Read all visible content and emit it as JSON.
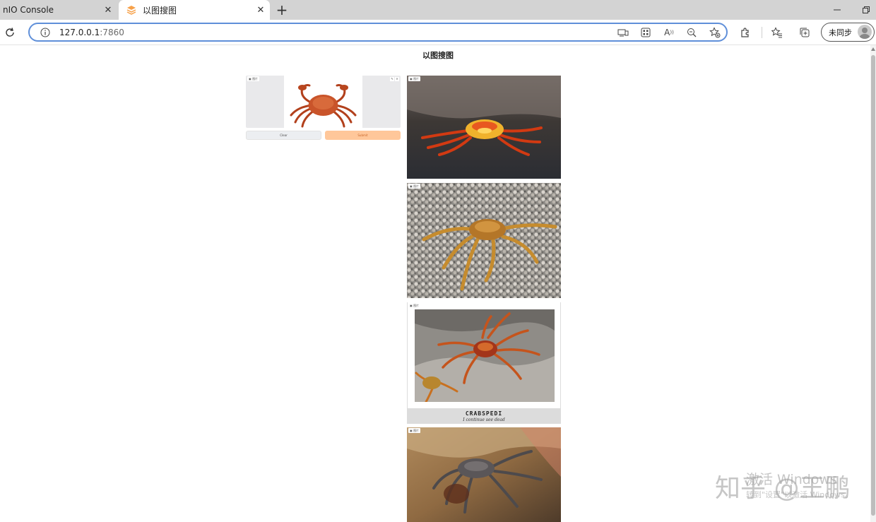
{
  "browser": {
    "tabs": [
      {
        "title": "nIO Console",
        "active": false
      },
      {
        "title": "以图搜图",
        "active": true
      }
    ],
    "new_tab_icon": "plus-icon",
    "address": {
      "host": "127.0.0.1",
      "port": ":7860"
    },
    "profile_label": "未同步"
  },
  "page": {
    "title": "以图搜图",
    "input": {
      "label": "图片"
    },
    "buttons": {
      "clear": "Clear",
      "submit": "Submit"
    },
    "gallery": [
      {
        "label": "图片"
      },
      {
        "label": "图片"
      },
      {
        "label": "图片",
        "caption_title": "CRABSPEDI",
        "caption_sub": "I continue see dead"
      },
      {
        "label": "图片"
      }
    ]
  },
  "watermarks": {
    "activate_title": "激活 Windows",
    "activate_sub": "转到\"设置\"以激活 Windows。",
    "zhihu": "知乎 @王鹏"
  },
  "colors": {
    "accent": "#ffc79a",
    "focus": "#5f8fd9"
  }
}
